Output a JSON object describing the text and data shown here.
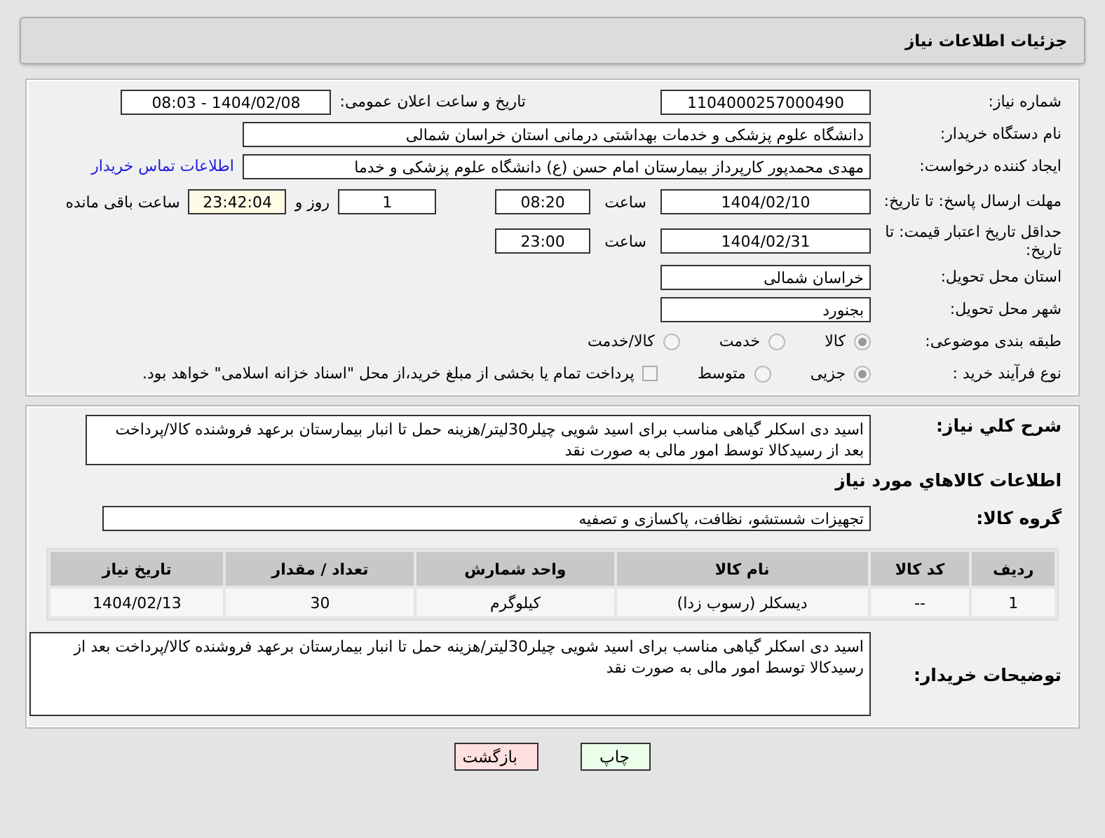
{
  "header": {
    "title": "جزئیات اطلاعات نیاز"
  },
  "need_number": {
    "label": "شماره نیاز:",
    "value": "1104000257000490"
  },
  "announce": {
    "label": "تاریخ و ساعت اعلان عمومی:",
    "value": "1404/02/08 - 08:03"
  },
  "buyer": {
    "label": "نام دستگاه خریدار:",
    "value": "دانشگاه علوم پزشکی و خدمات بهداشتی درمانی استان خراسان شمالی"
  },
  "creator": {
    "label": "ایجاد کننده درخواست:",
    "value": "مهدی محمدپور کارپرداز بیمارستان امام حسن (ع) دانشگاه علوم پزشکی و خدما",
    "link": "اطلاعات تماس خریدار"
  },
  "deadline": {
    "label": "مهلت ارسال پاسخ: تا تاریخ:",
    "date": "1404/02/10",
    "time_label": "ساعت",
    "time": "08:20",
    "days": "1",
    "days_label": "روز و",
    "remaining": "23:42:04",
    "remaining_label": "ساعت باقی مانده"
  },
  "validity": {
    "label": "حداقل تاریخ اعتبار قیمت: تا تاریخ:",
    "date": "1404/02/31",
    "time_label": "ساعت",
    "time": "23:00"
  },
  "province": {
    "label": "استان محل تحویل:",
    "value": "خراسان شمالی"
  },
  "city": {
    "label": "شهر محل تحویل:",
    "value": "بجنورد"
  },
  "category": {
    "label": "طبقه بندی موضوعی:",
    "options": [
      {
        "label": "کالا",
        "selected": true
      },
      {
        "label": "خدمت",
        "selected": false
      },
      {
        "label": "کالا/خدمت",
        "selected": false
      }
    ]
  },
  "process": {
    "label": "نوع فرآیند خرید :",
    "options": [
      {
        "label": "جزیی",
        "selected": true
      },
      {
        "label": "متوسط",
        "selected": false
      }
    ],
    "checkbox": {
      "label": "پرداخت تمام یا بخشی از مبلغ خرید،از محل \"اسناد خزانه اسلامی\" خواهد بود.",
      "checked": false
    }
  },
  "description": {
    "label": "شرح کلي نياز:",
    "value": "اسید دی اسکلر گیاهی مناسب برای اسید شویی چیلر30لیتر/هزینه حمل تا انبار بیمارستان برعهد فروشنده کالا/پرداخت بعد از رسیدکالا توسط امور مالی به صورت نقد"
  },
  "goods_title": "اطلاعات کالاهاي مورد نياز",
  "group": {
    "label": "گروه کالا:",
    "value": "تجهیزات شستشو، نظافت، پاکسازی و تصفیه"
  },
  "table": {
    "columns": [
      "ردیف",
      "کد کالا",
      "نام کالا",
      "واحد شمارش",
      "تعداد / مقدار",
      "تاریخ نیاز"
    ],
    "rows": [
      [
        "1",
        "--",
        "دیسکلر (رسوب زدا)",
        "کیلوگرم",
        "30",
        "1404/02/13"
      ]
    ]
  },
  "buyer_notes": {
    "label": "توضیحات خریدار:",
    "value": "اسید دی اسکلر گیاهی مناسب برای اسید شویی چیلر30لیتر/هزینه حمل تا انبار بیمارستان برعهد فروشنده کالا/پرداخت بعد از رسیدکالا توسط امور مالی به صورت نقد"
  },
  "buttons": [
    {
      "label": "چاپ",
      "kind": "print"
    },
    {
      "label": "بازگشت",
      "kind": "back"
    }
  ]
}
